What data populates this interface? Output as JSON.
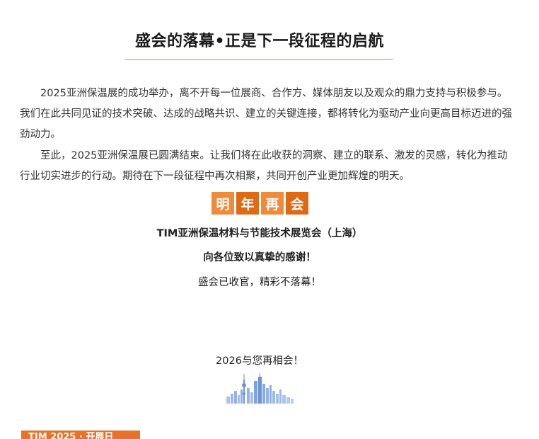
{
  "article": {
    "title": "盛会的落幕•正是下一段征程的启航",
    "paragraphs": [
      "2025亚洲保温展的成功举办，离不开每一位展商、合作方、媒体朋友以及观众的鼎力支持与积极参与。我们在此共同见证的技术突破、达成的战略共识、建立的关键连接，都将转化为驱动产业向更高目标迈进的强劲动力。",
      "至此，2025亚洲保温展已圆满结束。让我们将在此收获的洞察、建立的联系、激发的灵感，转化为推动行业切实进步的行动。期待在下一段征程中再次相聚，共同开创产业更加辉煌的明天。"
    ],
    "banner_chars": [
      "明",
      "年",
      "再",
      "会"
    ],
    "exhibition_name": "TIM亚洲保温材料与节能技术展览会（上海）",
    "thanks": "向各位致以真挚的感谢！",
    "closing": "盛会已收官，精彩不落幕！",
    "reunion": "2026与您再相会！",
    "bottom_tab_label": "TIM 2025 · 开展日"
  },
  "colors": {
    "accent": "#e06a14",
    "accent_light": "#ef8a3a",
    "rule": "#e0894d",
    "skyline": "#6a93d8"
  },
  "icons": {
    "skyline": "city-skyline-icon"
  }
}
